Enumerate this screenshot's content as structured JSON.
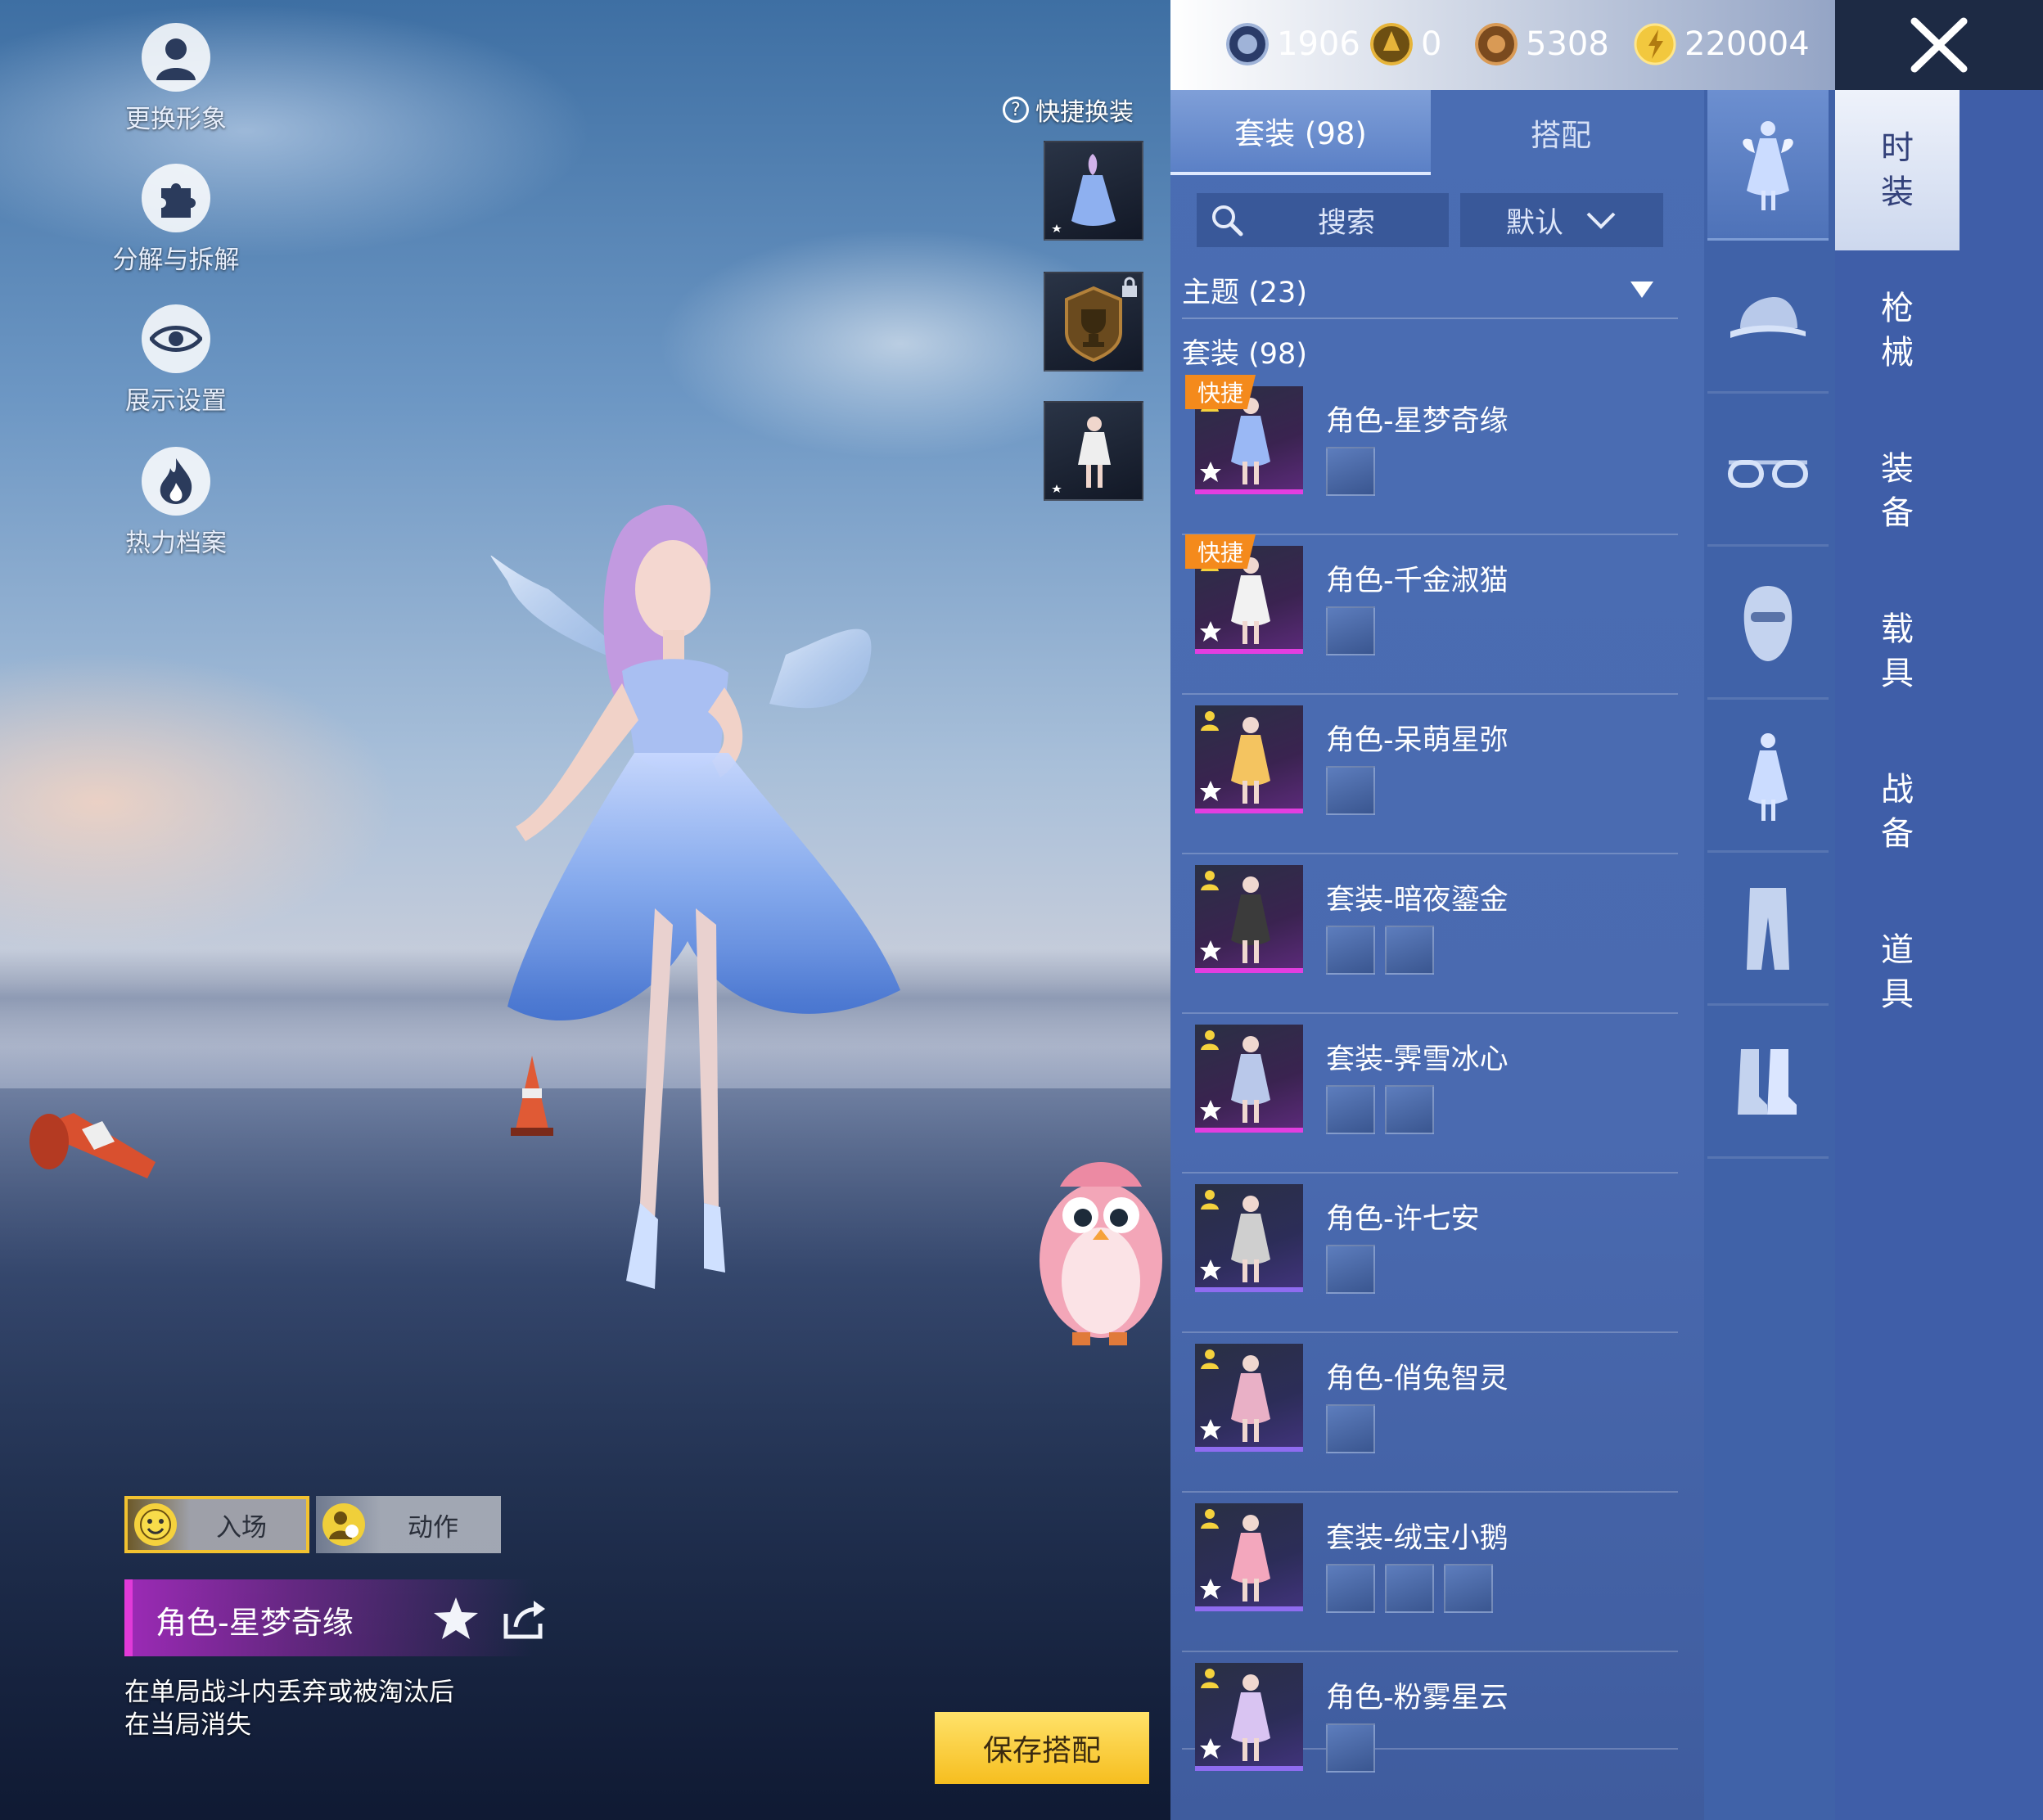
{
  "side_menu": [
    {
      "label": "更换形象",
      "icon": "avatar-icon"
    },
    {
      "label": "分解与拆解",
      "icon": "puzzle-icon"
    },
    {
      "label": "展示设置",
      "icon": "eye-icon"
    },
    {
      "label": "热力档案",
      "icon": "flame-icon"
    }
  ],
  "quick_swap": {
    "title": "快捷换装"
  },
  "currency": [
    {
      "value": "1906",
      "icon": "silver-coin-icon",
      "color": "#8aa0c8"
    },
    {
      "value": "0",
      "icon": "gold-emblem-icon",
      "color": "#c89b20"
    },
    {
      "value": "5308",
      "icon": "bronze-coin-icon",
      "color": "#b0742e"
    },
    {
      "value": "220004",
      "icon": "gold-coin-icon",
      "color": "#f0c43a"
    }
  ],
  "tabs": {
    "suits": "套装 (98)",
    "match": "搭配"
  },
  "search": {
    "placeholder": "搜索",
    "sort": "默认"
  },
  "filter": {
    "theme": "主题 (23)",
    "suit_header": "套装 (98)"
  },
  "items": [
    {
      "name": "角色-星梦奇缘",
      "quick": "快捷",
      "parts": 1
    },
    {
      "name": "角色-千金淑猫",
      "quick": "快捷",
      "parts": 1
    },
    {
      "name": "角色-呆萌星弥",
      "parts": 1
    },
    {
      "name": "套装-暗夜鎏金",
      "parts": 2
    },
    {
      "name": "套装-霁雪冰心",
      "parts": 2
    },
    {
      "name": "角色-许七安",
      "parts": 1
    },
    {
      "name": "角色-俏兔智灵",
      "parts": 1
    },
    {
      "name": "套装-绒宝小鹅",
      "parts": 3
    },
    {
      "name": "角色-粉雾星云",
      "parts": 1
    }
  ],
  "main_tabs": [
    "时装",
    "枪械",
    "装备",
    "载具",
    "战备",
    "道具"
  ],
  "bottom": {
    "entry_label": "入场",
    "action_label": "动作",
    "outfit_name": "角色-星梦奇缘",
    "description": "在单局战斗内丢弃或被淘汰后\n在当局消失",
    "save_label": "保存搭配"
  },
  "colors": {
    "accent_gold": "#f6be1f",
    "rarity_pink": "#e23ee0",
    "rarity_purple": "#8f6cf0",
    "quick_orange": "#f48a1c"
  }
}
